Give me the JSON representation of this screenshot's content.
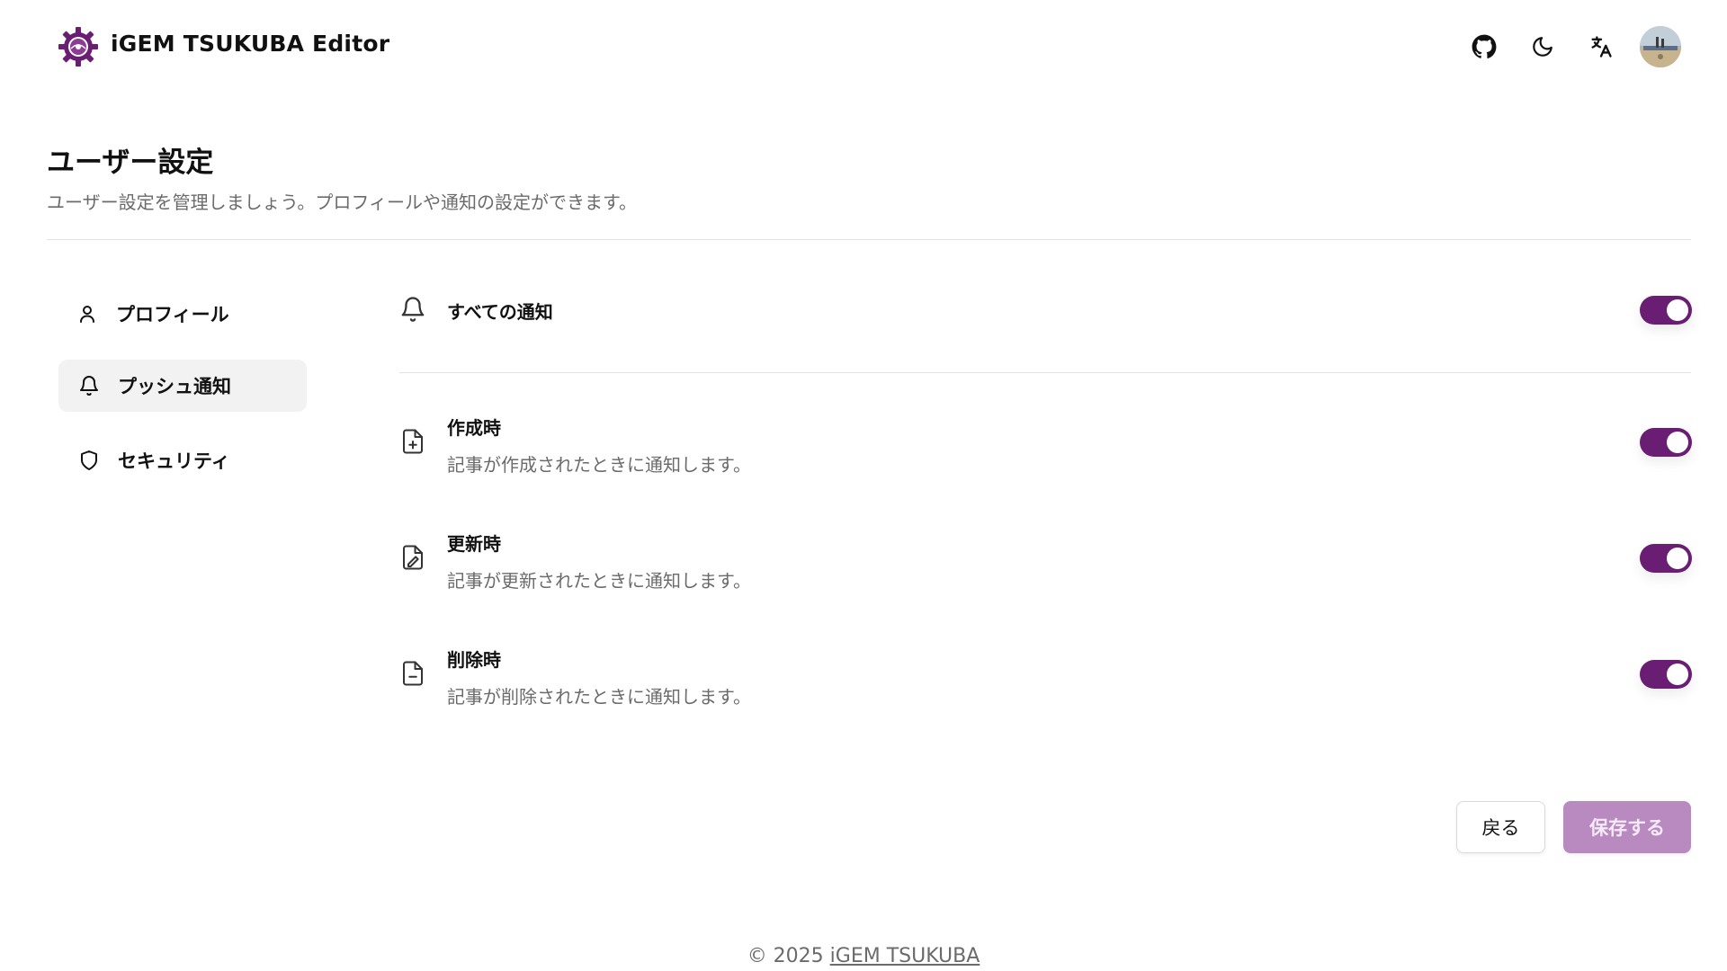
{
  "header": {
    "app_title": "iGEM TSUKUBA Editor",
    "icons": [
      "gear-logo",
      "github-icon",
      "moon-icon",
      "translate-icon",
      "avatar"
    ]
  },
  "page": {
    "title": "ユーザー設定",
    "description": "ユーザー設定を管理しましょう。プロフィールや通知の設定ができます。"
  },
  "sidebar": {
    "items": [
      {
        "label": "プロフィール",
        "icon": "user-icon",
        "active": false
      },
      {
        "label": "プッシュ通知",
        "icon": "bell-icon",
        "active": true
      },
      {
        "label": "セキュリティ",
        "icon": "shield-icon",
        "active": false
      }
    ]
  },
  "notifications": {
    "all": {
      "label": "すべての通知",
      "icon": "bell-icon",
      "enabled": true
    },
    "items": [
      {
        "title": "作成時",
        "description": "記事が作成されたときに通知します。",
        "icon": "file-plus-icon",
        "enabled": true
      },
      {
        "title": "更新時",
        "description": "記事が更新されたときに通知します。",
        "icon": "file-edit-icon",
        "enabled": true
      },
      {
        "title": "削除時",
        "description": "記事が削除されたときに通知します。",
        "icon": "file-minus-icon",
        "enabled": true
      }
    ]
  },
  "actions": {
    "back_label": "戻る",
    "save_label": "保存する"
  },
  "footer": {
    "copyright": "© 2025",
    "link_label": "iGEM TSUKUBA"
  },
  "colors": {
    "accent": "#6a1e73",
    "save_button": "#b98ac0",
    "active_sidebar_bg": "#f2f2f2"
  }
}
